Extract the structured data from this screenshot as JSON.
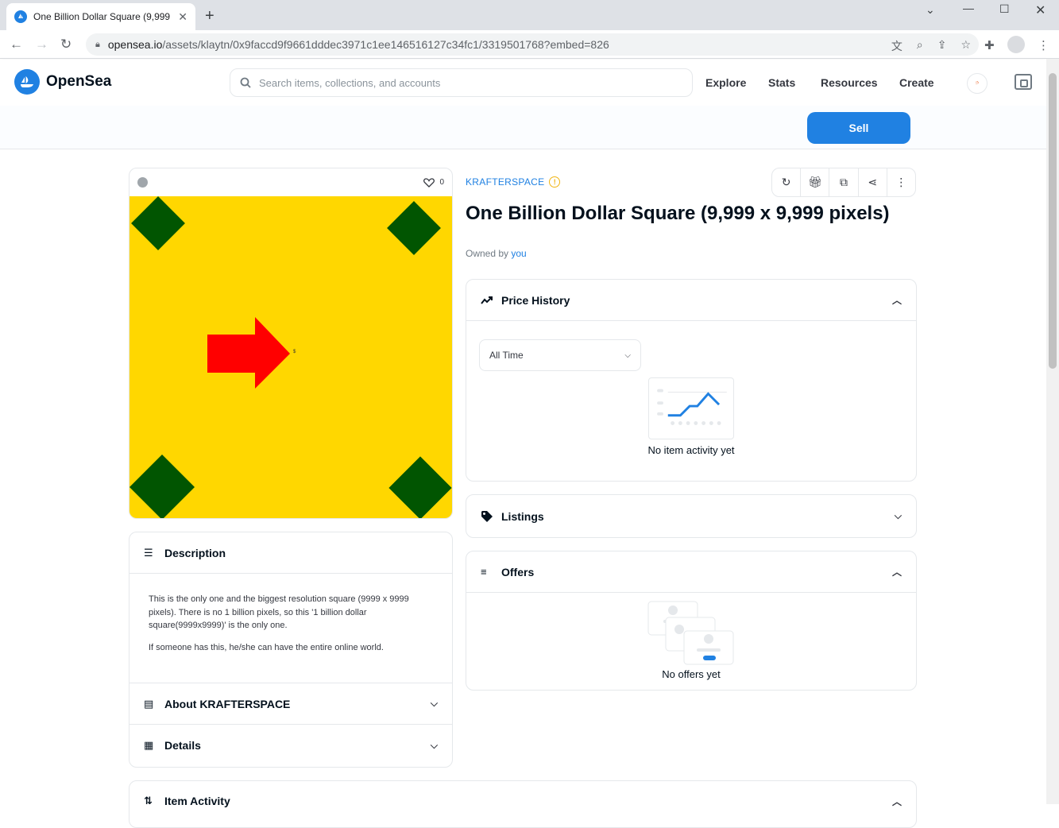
{
  "browser": {
    "tab_title": "One Billion Dollar Square (9,999",
    "url_domain": "opensea.io",
    "url_path": "/assets/klaytn/0x9faccd9f9661dddec3971c1ee146516127c34fc1/3319501768?embed=826"
  },
  "header": {
    "brand": "OpenSea",
    "search_placeholder": "Search items, collections, and accounts",
    "nav": [
      "Explore",
      "Stats",
      "Resources",
      "Create"
    ],
    "avatar_text": "ኃ"
  },
  "subbar": {
    "sell_label": "Sell"
  },
  "asset": {
    "favorite_count": "0",
    "collection": "KRAFTERSPACE",
    "title": "One Billion Dollar Square (9,999 x 9,999 pixels)",
    "owned_by_label": "Owned by",
    "owner": "you",
    "image_dollar_sign": "$"
  },
  "description": {
    "heading": "Description",
    "paragraphs": [
      "This is the only one and the biggest resolution square (9999 x 9999 pixels). There is no 1 billion pixels, so this '1 billion dollar square(9999x9999)' is the only one.",
      "If someone has this, he/she can have the entire online world."
    ],
    "about_heading": "About KRAFTERSPACE",
    "details_heading": "Details"
  },
  "price_history": {
    "heading": "Price History",
    "filter_value": "All Time",
    "empty_text": "No item activity yet"
  },
  "listings": {
    "heading": "Listings"
  },
  "offers": {
    "heading": "Offers",
    "empty_text": "No offers yet"
  },
  "activity": {
    "heading": "Item Activity"
  },
  "colors": {
    "accent": "#2081e2",
    "nft_bg": "#ffd700",
    "diamond": "#015501",
    "arrow": "#ff0000"
  }
}
